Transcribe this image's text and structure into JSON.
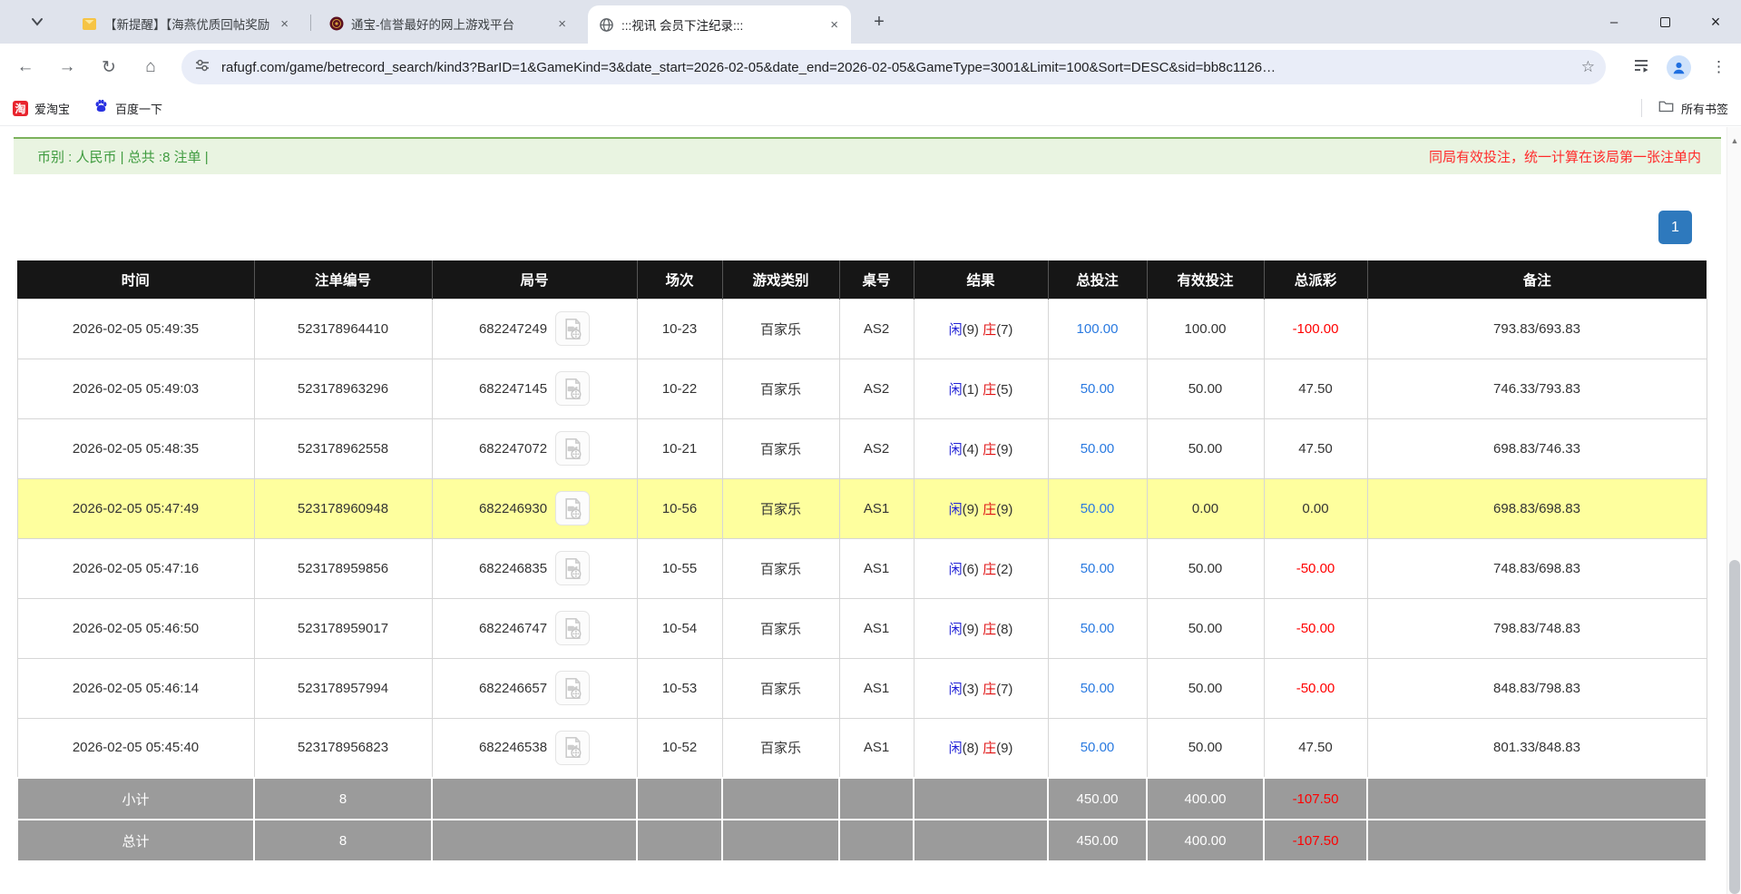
{
  "browser": {
    "glyphs": {
      "close": "×",
      "plus": "+",
      "dots": "⋮",
      "star": "☆",
      "back": "←",
      "forward": "→",
      "reload": "↻",
      "home": "⌂",
      "minimize": "–",
      "up_arrow": "▲"
    },
    "tabs": [
      {
        "title": "【新提醒】【海燕优质回帖奖励"
      },
      {
        "title": "通宝-信誉最好的网上游戏平台"
      },
      {
        "title": ":::视讯 会员下注纪录:::"
      }
    ],
    "omnibox": {
      "url": "rafugf.com/game/betrecord_search/kind3?BarID=1&GameKind=3&date_start=2026-02-05&date_end=2026-02-05&GameType=3001&Limit=100&Sort=DESC&sid=bb8c1126…"
    },
    "bookmarks": {
      "items": [
        {
          "label": "爱淘宝",
          "badge": "淘"
        },
        {
          "label": "百度一下"
        }
      ],
      "all_label": "所有书签"
    }
  },
  "page": {
    "summary": "币别 : 人民币 | 总共 :8 注单 |",
    "notice": "同局有效投注，统一计算在该局第一张注单内",
    "pagination": "1",
    "table": {
      "headers": [
        "时间",
        "注单编号",
        "局号",
        "场次",
        "游戏类别",
        "桌号",
        "结果",
        "总投注",
        "有效投注",
        "总派彩",
        "备注"
      ],
      "result_player_label": "闲",
      "result_banker_label": "庄",
      "rows": [
        {
          "time": "2026-02-05 05:49:35",
          "bet_id": "523178964410",
          "round": "682247249",
          "session": "10-23",
          "game": "百家乐",
          "table": "AS2",
          "player": "9",
          "banker": "7",
          "total_bet": "100.00",
          "valid_bet": "100.00",
          "payout": "-100.00",
          "remark": "793.83/693.83",
          "highlight": false
        },
        {
          "time": "2026-02-05 05:49:03",
          "bet_id": "523178963296",
          "round": "682247145",
          "session": "10-22",
          "game": "百家乐",
          "table": "AS2",
          "player": "1",
          "banker": "5",
          "total_bet": "50.00",
          "valid_bet": "50.00",
          "payout": "47.50",
          "remark": "746.33/793.83",
          "highlight": false
        },
        {
          "time": "2026-02-05 05:48:35",
          "bet_id": "523178962558",
          "round": "682247072",
          "session": "10-21",
          "game": "百家乐",
          "table": "AS2",
          "player": "4",
          "banker": "9",
          "total_bet": "50.00",
          "valid_bet": "50.00",
          "payout": "47.50",
          "remark": "698.83/746.33",
          "highlight": false
        },
        {
          "time": "2026-02-05 05:47:49",
          "bet_id": "523178960948",
          "round": "682246930",
          "session": "10-56",
          "game": "百家乐",
          "table": "AS1",
          "player": "9",
          "banker": "9",
          "total_bet": "50.00",
          "valid_bet": "0.00",
          "payout": "0.00",
          "remark": "698.83/698.83",
          "highlight": true
        },
        {
          "time": "2026-02-05 05:47:16",
          "bet_id": "523178959856",
          "round": "682246835",
          "session": "10-55",
          "game": "百家乐",
          "table": "AS1",
          "player": "6",
          "banker": "2",
          "total_bet": "50.00",
          "valid_bet": "50.00",
          "payout": "-50.00",
          "remark": "748.83/698.83",
          "highlight": false
        },
        {
          "time": "2026-02-05 05:46:50",
          "bet_id": "523178959017",
          "round": "682246747",
          "session": "10-54",
          "game": "百家乐",
          "table": "AS1",
          "player": "9",
          "banker": "8",
          "total_bet": "50.00",
          "valid_bet": "50.00",
          "payout": "-50.00",
          "remark": "798.83/748.83",
          "highlight": false
        },
        {
          "time": "2026-02-05 05:46:14",
          "bet_id": "523178957994",
          "round": "682246657",
          "session": "10-53",
          "game": "百家乐",
          "table": "AS1",
          "player": "3",
          "banker": "7",
          "total_bet": "50.00",
          "valid_bet": "50.00",
          "payout": "-50.00",
          "remark": "848.83/798.83",
          "highlight": false
        },
        {
          "time": "2026-02-05 05:45:40",
          "bet_id": "523178956823",
          "round": "682246538",
          "session": "10-52",
          "game": "百家乐",
          "table": "AS1",
          "player": "8",
          "banker": "9",
          "total_bet": "50.00",
          "valid_bet": "50.00",
          "payout": "47.50",
          "remark": "801.33/848.83",
          "highlight": false
        }
      ],
      "subtotal": {
        "label": "小计",
        "count": "8",
        "total_bet": "450.00",
        "valid_bet": "400.00",
        "payout": "-107.50"
      },
      "total": {
        "label": "总计",
        "count": "8",
        "total_bet": "450.00",
        "valid_bet": "400.00",
        "payout": "-107.50"
      }
    }
  },
  "colors": {
    "header_bg": "#161616",
    "highlight_row": "#feff9e",
    "footer_bg": "#9b9b9b",
    "bet_blue": "#2a7ae0",
    "player_blue": "#2323d6",
    "banker_red": "#e01414",
    "negative_red": "#ff0000",
    "pagination_blue": "#2e79bd",
    "summary_bg": "#e9f4e1",
    "summary_border": "#7cb25c",
    "summary_text_green": "#3f9b3f",
    "notice_red": "#ff2a2a"
  }
}
